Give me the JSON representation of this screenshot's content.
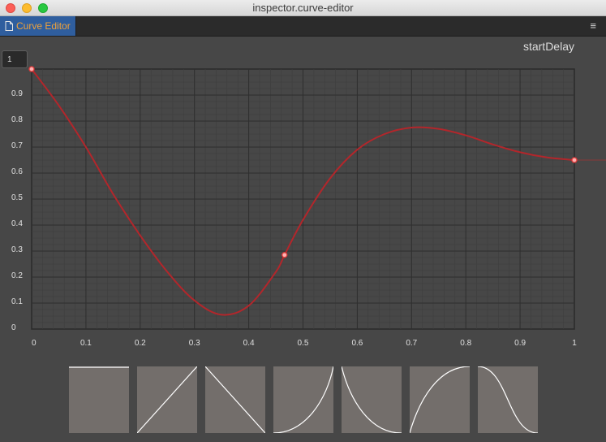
{
  "window": {
    "title": "inspector.curve-editor"
  },
  "tab": {
    "icon": "document-icon",
    "label": "Curve Editor"
  },
  "menu": {
    "icon": "hamburger-menu-icon",
    "glyph": "≡"
  },
  "property_name": "startDelay",
  "max_value_input": "1",
  "chart_data": {
    "type": "line",
    "title": "",
    "xlabel": "",
    "ylabel": "",
    "xlim": [
      0,
      1
    ],
    "ylim": [
      0,
      1
    ],
    "grid": true,
    "x_ticks": [
      "0",
      "0.1",
      "0.2",
      "0.3",
      "0.4",
      "0.5",
      "0.6",
      "0.7",
      "0.8",
      "0.9",
      "1"
    ],
    "y_ticks": [
      "0",
      "0.1",
      "0.2",
      "0.3",
      "0.4",
      "0.5",
      "0.6",
      "0.7",
      "0.8",
      "0.9"
    ],
    "keyframes": [
      {
        "x": 0,
        "y": 1.0
      },
      {
        "x": 0.466,
        "y": 0.285
      },
      {
        "x": 1.0,
        "y": 0.65
      }
    ],
    "series": [
      {
        "color": "#b3262b",
        "x": [
          0,
          0.05,
          0.1,
          0.15,
          0.2,
          0.25,
          0.3,
          0.35,
          0.4,
          0.45,
          0.466,
          0.5,
          0.55,
          0.6,
          0.65,
          0.7,
          0.75,
          0.8,
          0.85,
          0.9,
          0.95,
          1.0
        ],
        "y": [
          1.0,
          0.86,
          0.7,
          0.52,
          0.36,
          0.22,
          0.11,
          0.055,
          0.09,
          0.22,
          0.285,
          0.42,
          0.58,
          0.69,
          0.75,
          0.775,
          0.77,
          0.745,
          0.71,
          0.68,
          0.66,
          0.65
        ]
      }
    ]
  },
  "presets": [
    {
      "name": "constant",
      "icon": "preset-constant-icon"
    },
    {
      "name": "linear",
      "icon": "preset-linear-icon"
    },
    {
      "name": "linear-down",
      "icon": "preset-linear-down-icon"
    },
    {
      "name": "ease-in",
      "icon": "preset-ease-in-icon"
    },
    {
      "name": "ease-out-down",
      "icon": "preset-ease-out-down-icon"
    },
    {
      "name": "ease-out",
      "icon": "preset-ease-out-icon"
    },
    {
      "name": "ease-in-out-down",
      "icon": "preset-ease-in-out-down-icon"
    }
  ],
  "colors": {
    "background": "#474747",
    "curve": "#b3262b",
    "grid_major": "#2e2e2e",
    "grid_minor": "#3e3e3e",
    "tab_active": "#2f5e9e",
    "tab_label": "#f0a23a",
    "preset_bg": "#736e6b"
  }
}
